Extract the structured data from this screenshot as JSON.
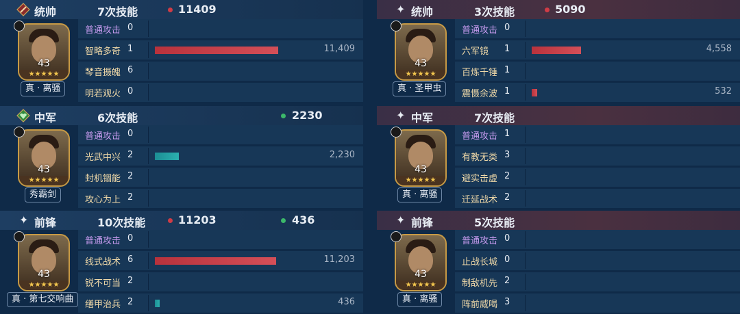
{
  "panels": [
    {
      "side": "left",
      "role": "统帅",
      "count": "7次技能",
      "damage": "11409",
      "heal": "",
      "level": "43",
      "stars": "★★★★★",
      "name": "真 · 离骚",
      "skills": [
        {
          "name": "普通攻击",
          "count": "0",
          "basic": true,
          "bar": 0,
          "bar_color": "",
          "value": ""
        },
        {
          "name": "智略多奇",
          "count": "1",
          "basic": false,
          "bar": 1.0,
          "bar_color": "red",
          "value": "11,409"
        },
        {
          "name": "琴音摄魄",
          "count": "6",
          "basic": false,
          "bar": 0,
          "bar_color": "",
          "value": ""
        },
        {
          "name": "明若观火",
          "count": "0",
          "basic": false,
          "bar": 0,
          "bar_color": "",
          "value": ""
        }
      ]
    },
    {
      "side": "right",
      "role": "统帅",
      "count": "3次技能",
      "damage": "5090",
      "heal": "",
      "level": "43",
      "stars": "★★★★★",
      "name": "真 · 圣甲虫",
      "skills": [
        {
          "name": "普通攻击",
          "count": "0",
          "basic": true,
          "bar": 0,
          "bar_color": "",
          "value": ""
        },
        {
          "name": "六军镜",
          "count": "1",
          "basic": false,
          "bar": 0.4,
          "bar_color": "red",
          "value": "4,558"
        },
        {
          "name": "百炼千锤",
          "count": "1",
          "basic": false,
          "bar": 0,
          "bar_color": "",
          "value": ""
        },
        {
          "name": "震慑余波",
          "count": "1",
          "basic": false,
          "bar": 0.047,
          "bar_color": "red",
          "value": "532"
        }
      ]
    },
    {
      "side": "left",
      "role": "中军",
      "count": "6次技能",
      "damage": "",
      "heal": "2230",
      "level": "43",
      "stars": "★★★★★",
      "name": "秀霸剑",
      "skills": [
        {
          "name": "普通攻击",
          "count": "0",
          "basic": true,
          "bar": 0,
          "bar_color": "",
          "value": ""
        },
        {
          "name": "光武中兴",
          "count": "2",
          "basic": false,
          "bar": 0.195,
          "bar_color": "teal",
          "value": "2,230"
        },
        {
          "name": "封机锢能",
          "count": "2",
          "basic": false,
          "bar": 0,
          "bar_color": "",
          "value": ""
        },
        {
          "name": "攻心为上",
          "count": "2",
          "basic": false,
          "bar": 0,
          "bar_color": "",
          "value": ""
        }
      ]
    },
    {
      "side": "right",
      "role": "中军",
      "count": "7次技能",
      "damage": "",
      "heal": "",
      "level": "43",
      "stars": "★★★★★",
      "name": "真 · 离骚",
      "skills": [
        {
          "name": "普通攻击",
          "count": "1",
          "basic": true,
          "bar": 0,
          "bar_color": "",
          "value": ""
        },
        {
          "name": "有教无类",
          "count": "3",
          "basic": false,
          "bar": 0,
          "bar_color": "",
          "value": ""
        },
        {
          "name": "避实击虚",
          "count": "2",
          "basic": false,
          "bar": 0,
          "bar_color": "",
          "value": ""
        },
        {
          "name": "迁延战术",
          "count": "2",
          "basic": false,
          "bar": 0,
          "bar_color": "",
          "value": ""
        }
      ]
    },
    {
      "side": "left",
      "role": "前锋",
      "count": "10次技能",
      "damage": "11203",
      "heal": "436",
      "level": "43",
      "stars": "★★★★★",
      "name": "真 · 第七交响曲",
      "skills": [
        {
          "name": "普通攻击",
          "count": "0",
          "basic": true,
          "bar": 0,
          "bar_color": "",
          "value": ""
        },
        {
          "name": "线式战术",
          "count": "6",
          "basic": false,
          "bar": 0.982,
          "bar_color": "red",
          "value": "11,203"
        },
        {
          "name": "锐不可当",
          "count": "2",
          "basic": false,
          "bar": 0,
          "bar_color": "",
          "value": ""
        },
        {
          "name": "缮甲治兵",
          "count": "2",
          "basic": false,
          "bar": 0.038,
          "bar_color": "teal",
          "value": "436"
        }
      ]
    },
    {
      "side": "right",
      "role": "前锋",
      "count": "5次技能",
      "damage": "",
      "heal": "",
      "level": "43",
      "stars": "★★★★★",
      "name": "真 · 离骚",
      "skills": [
        {
          "name": "普通攻击",
          "count": "0",
          "basic": true,
          "bar": 0,
          "bar_color": "",
          "value": ""
        },
        {
          "name": "止战长城",
          "count": "0",
          "basic": false,
          "bar": 0,
          "bar_color": "",
          "value": ""
        },
        {
          "name": "制敌机先",
          "count": "2",
          "basic": false,
          "bar": 0,
          "bar_color": "",
          "value": ""
        },
        {
          "name": "阵前威喝",
          "count": "3",
          "basic": false,
          "bar": 0,
          "bar_color": "",
          "value": ""
        }
      ]
    }
  ]
}
